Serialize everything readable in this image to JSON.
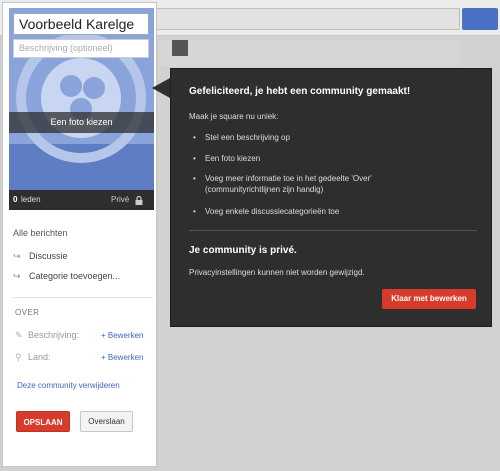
{
  "community": {
    "name": "Voorbeeld Karelge",
    "description_placeholder": "Beschrijving (optioneel)",
    "photo_button": "Een foto kiezen",
    "members_count": "0",
    "members_label": "leden",
    "privacy": "Privé"
  },
  "nav": {
    "all_posts": "Alle berichten",
    "items": [
      {
        "label": "Discussie",
        "icon": "arrow-right-icon"
      },
      {
        "label": "Categorie toevoegen...",
        "icon": "arrow-right-icon"
      }
    ]
  },
  "about": {
    "section_label": "OVER",
    "rows": [
      {
        "label": "Beschrijving:",
        "icon": "pencil-icon",
        "action": "+ Bewerken"
      },
      {
        "label": "Land:",
        "icon": "location-pin-icon",
        "action": "+ Bewerken"
      }
    ],
    "delete_link": "Deze community verwijderen"
  },
  "actions": {
    "save": "OPSLAAN",
    "skip": "Overslaan"
  },
  "tooltip": {
    "title": "Gefeliciteerd, je hebt een community gemaakt!",
    "intro": "Maak je square nu uniek:",
    "items": [
      "Stel een beschrijving op",
      "Een foto kiezen",
      "Voeg meer informatie toe in het gedeelte 'Over' (communityrichtlijnen zijn handig)",
      "Voeg enkele discussiecategorieën toe"
    ],
    "private_title": "Je community is privé.",
    "private_note": "Privacyinstellingen kunnen niet worden gewijzigd.",
    "done_button": "Klaar met bewerken"
  },
  "colors": {
    "accent_red": "#d73b2c",
    "link_blue": "#3e64c6",
    "tooltip_bg": "#2e2e2e",
    "cover_blue": "#8aa3da"
  }
}
